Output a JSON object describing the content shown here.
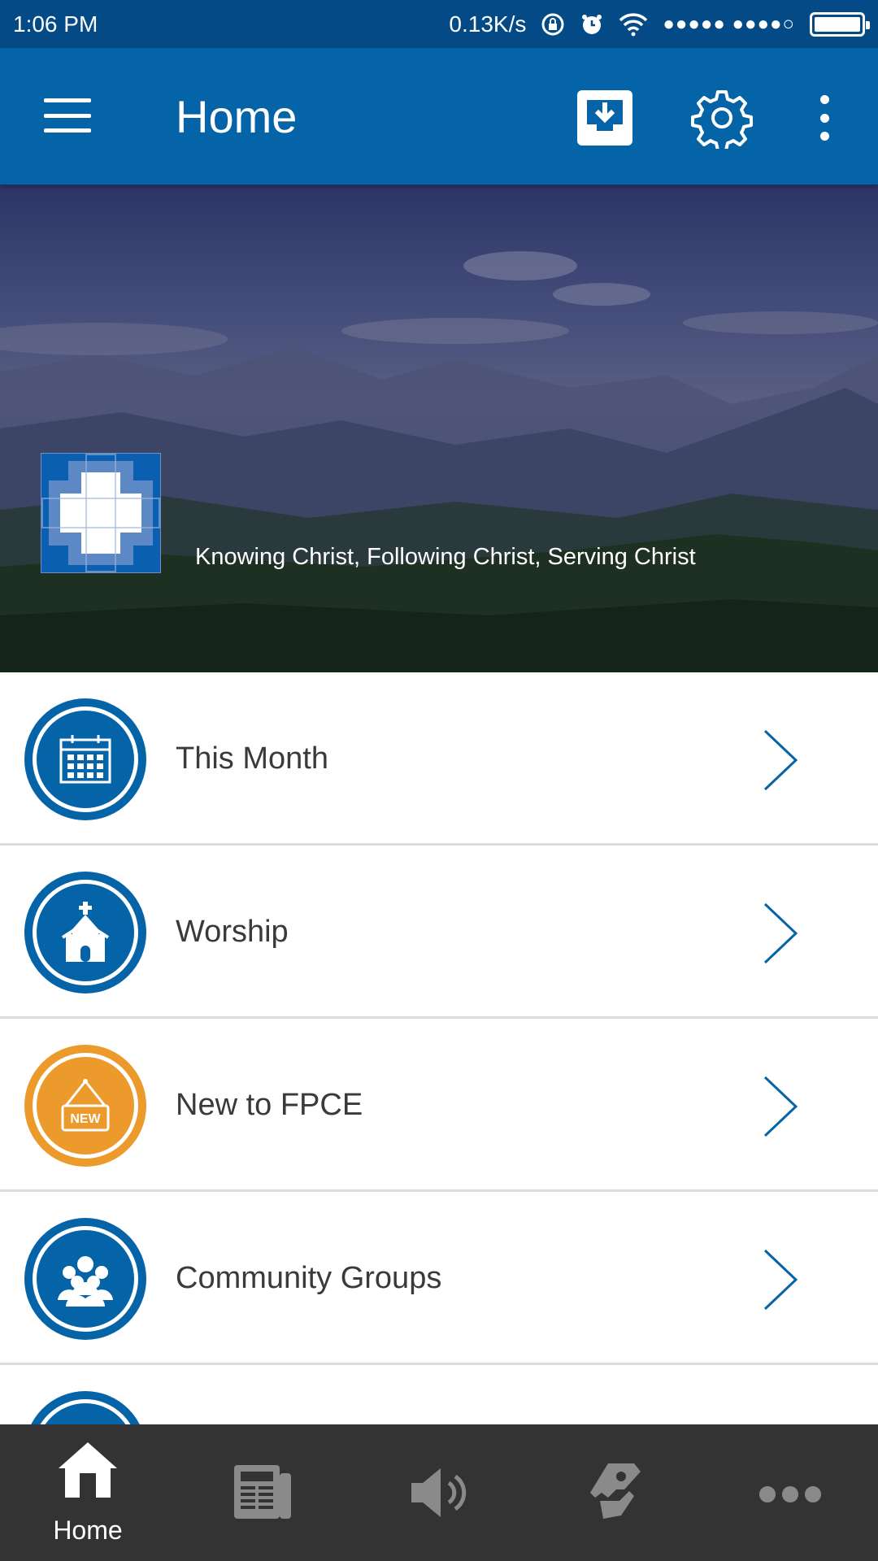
{
  "status_bar": {
    "time": "1:06 PM",
    "network_speed": "0.13K/s",
    "signal_dots": "●●●●● ●●●●○"
  },
  "app_bar": {
    "title": "Home"
  },
  "hero": {
    "tagline": "Knowing Christ, Following Christ, Serving Christ"
  },
  "list": {
    "items": [
      {
        "label": "This Month",
        "icon": "calendar-icon",
        "color": "#0564a8"
      },
      {
        "label": "Worship",
        "icon": "church-icon",
        "color": "#0564a8"
      },
      {
        "label": "New to FPCE",
        "icon": "new-sign-icon",
        "color": "#ec9a2b",
        "icon_text": "NEW"
      },
      {
        "label": "Community Groups",
        "icon": "people-icon",
        "color": "#0564a8"
      }
    ]
  },
  "bottom_nav": {
    "items": [
      {
        "label": "Home",
        "icon": "home-icon",
        "active": true
      },
      {
        "label": "",
        "icon": "newspaper-icon"
      },
      {
        "label": "",
        "icon": "speaker-icon"
      },
      {
        "label": "",
        "icon": "giving-hand-icon"
      },
      {
        "label": "",
        "icon": "more-dots-icon"
      }
    ]
  },
  "colors": {
    "brand_blue": "#0564a8",
    "status_blue": "#034a86",
    "accent_orange": "#ec9a2b",
    "nav_bg": "#333333",
    "inactive_icon": "#8a8a8a"
  }
}
